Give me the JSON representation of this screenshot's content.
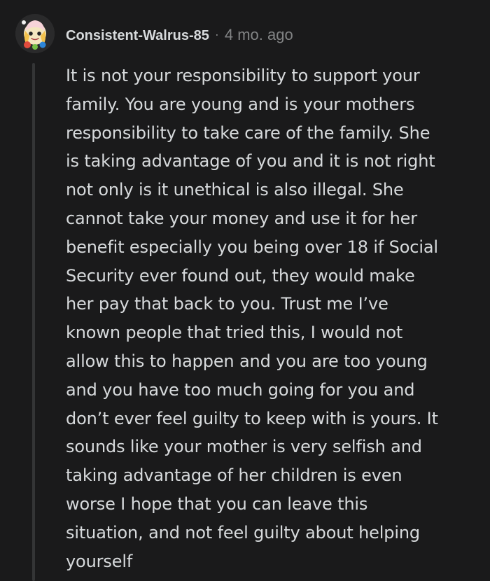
{
  "comment": {
    "author": "Consistent-Walrus-85",
    "separator": "·",
    "timestamp": "4 mo. ago",
    "avatar_icon": "snoo-avatar-icon",
    "body": "It is not your responsibility to support your\nfamily. You are young and is your mothers\nresponsibility to take care of the family. She\nis taking advantage of you and it is not right\nnot only is it unethical is also illegal. She\ncannot take your money and use it for her\nbenefit especially you being over 18 if Social\nSecurity ever found out, they would make\nher pay that back to you. Trust me I’ve\nknown people that tried this, I would not\nallow this to happen and you are too young\nand you have too much going for you and\ndon’t ever feel guilty to keep with is yours. It\nsounds like your mother is very selfish and\ntaking advantage of her children is even\nworse I hope that you can leave this\nsituation, and not feel guilty about helping\nyourself"
  },
  "colors": {
    "background": "#1a1a1b",
    "text": "#d7dadc",
    "meta": "#818384",
    "thread_line": "#343536"
  }
}
